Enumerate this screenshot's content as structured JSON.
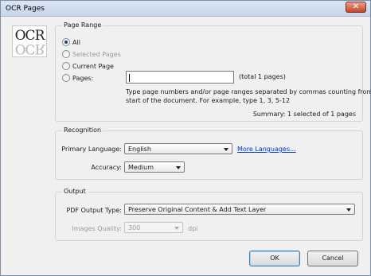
{
  "window": {
    "title": "OCR Pages",
    "close_glyph": "✕"
  },
  "logo": {
    "text": "OCR"
  },
  "page_range": {
    "legend": "Page Range",
    "options": {
      "all": "All",
      "selected_pages": "Selected Pages",
      "current_page": "Current Page",
      "pages": "Pages:"
    },
    "selected_option": "all",
    "pages_input_value": "",
    "total_pages_text": "(total 1 pages)",
    "hint_line1": "Type page numbers and/or page ranges separated by commas counting from the",
    "hint_line2": "start of the document. For example, type 1, 3, 5-12",
    "summary": "Summary: 1 selected of 1 pages"
  },
  "recognition": {
    "legend": "Recognition",
    "primary_language_label": "Primary Language:",
    "primary_language_value": "English",
    "more_languages_link": "More Languages...",
    "accuracy_label": "Accuracy:",
    "accuracy_value": "Medium"
  },
  "output": {
    "legend": "Output",
    "pdf_output_type_label": "PDF Output Type:",
    "pdf_output_type_value": "Preserve Original Content & Add Text Layer",
    "images_quality_label": "Images Quality:",
    "images_quality_value": "300",
    "images_quality_unit": "dpi"
  },
  "buttons": {
    "ok": "OK",
    "cancel": "Cancel"
  }
}
